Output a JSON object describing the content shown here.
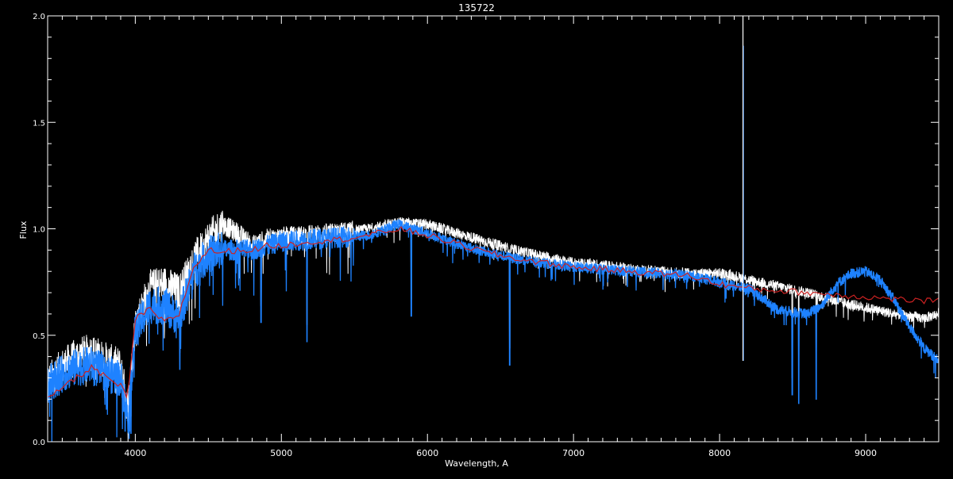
{
  "chart_data": {
    "type": "line",
    "title": "135722",
    "xlabel": "Wavelength, A",
    "ylabel": "Flux",
    "xlim": [
      3400,
      9500
    ],
    "ylim": [
      0.0,
      2.0
    ],
    "x_ticks": [
      4000,
      5000,
      6000,
      7000,
      8000,
      9000
    ],
    "x_tick_labels": [
      "4000",
      "5000",
      "6000",
      "7000",
      "8000",
      "9000"
    ],
    "y_ticks": [
      0.0,
      0.5,
      1.0,
      1.5,
      2.0
    ],
    "y_tick_labels": [
      "0.0",
      "0.5",
      "1.0",
      "1.5",
      "2.0"
    ],
    "grid": false,
    "background": "#000000",
    "series": [
      {
        "color": "#ffffff",
        "style": "noisy-spectrum",
        "x": [
          3400,
          3500,
          3600,
          3700,
          3800,
          3900,
          3950,
          4000,
          4100,
          4200,
          4300,
          4400,
          4500,
          4600,
          4700,
          4800,
          4900,
          5000,
          5200,
          5400,
          5600,
          5800,
          6000,
          6200,
          6400,
          6600,
          6800,
          7000,
          7200,
          7400,
          7600,
          7800,
          8000,
          8100,
          8200,
          8400,
          8600,
          8800,
          9000,
          9200,
          9400,
          9500
        ],
        "y": [
          0.28,
          0.35,
          0.4,
          0.42,
          0.38,
          0.35,
          0.15,
          0.55,
          0.72,
          0.74,
          0.7,
          0.85,
          0.95,
          1.02,
          0.98,
          0.92,
          0.95,
          0.96,
          0.97,
          0.98,
          1.0,
          1.03,
          1.02,
          0.98,
          0.94,
          0.9,
          0.87,
          0.84,
          0.83,
          0.81,
          0.8,
          0.79,
          0.79,
          0.78,
          0.76,
          0.73,
          0.7,
          0.66,
          0.63,
          0.6,
          0.58,
          0.6
        ]
      },
      {
        "color": "#1e82ff",
        "style": "noisy-spectrum",
        "x": [
          3400,
          3500,
          3600,
          3700,
          3800,
          3900,
          3950,
          4000,
          4100,
          4200,
          4300,
          4400,
          4500,
          4600,
          4700,
          4800,
          4900,
          5000,
          5200,
          5400,
          5600,
          5800,
          6000,
          6200,
          6400,
          6600,
          6800,
          7000,
          7200,
          7400,
          7600,
          7800,
          8000,
          8100,
          8200,
          8400,
          8600,
          8700,
          8800,
          8900,
          9000,
          9100,
          9200,
          9300,
          9400,
          9500
        ],
        "y": [
          0.27,
          0.32,
          0.35,
          0.36,
          0.32,
          0.3,
          0.12,
          0.52,
          0.64,
          0.64,
          0.58,
          0.8,
          0.88,
          0.9,
          0.9,
          0.9,
          0.92,
          0.94,
          0.95,
          0.96,
          0.97,
          1.02,
          0.98,
          0.93,
          0.89,
          0.86,
          0.84,
          0.82,
          0.81,
          0.8,
          0.79,
          0.78,
          0.75,
          0.73,
          0.72,
          0.62,
          0.6,
          0.64,
          0.74,
          0.79,
          0.8,
          0.76,
          0.66,
          0.54,
          0.44,
          0.38
        ]
      },
      {
        "color": "#cc2222",
        "style": "smooth-stepped",
        "x": [
          3400,
          3450,
          3500,
          3600,
          3700,
          3800,
          3900,
          3950,
          4000,
          4100,
          4200,
          4300,
          4400,
          4500,
          4600,
          4700,
          4800,
          4900,
          5000,
          5200,
          5400,
          5600,
          5800,
          6000,
          6200,
          6400,
          6600,
          6800,
          7000,
          7200,
          7400,
          7600,
          7800,
          8000,
          8200,
          8400,
          8600,
          8800,
          9000,
          9200,
          9400,
          9500
        ],
        "y": [
          0.2,
          0.22,
          0.26,
          0.3,
          0.35,
          0.3,
          0.26,
          0.2,
          0.58,
          0.62,
          0.56,
          0.6,
          0.82,
          0.9,
          0.89,
          0.9,
          0.9,
          0.92,
          0.92,
          0.94,
          0.95,
          0.97,
          1.0,
          0.97,
          0.93,
          0.89,
          0.86,
          0.84,
          0.82,
          0.81,
          0.8,
          0.79,
          0.78,
          0.74,
          0.72,
          0.71,
          0.7,
          0.69,
          0.68,
          0.67,
          0.66,
          0.66
        ]
      }
    ],
    "emission_spikes": [
      {
        "x": 8163,
        "y": 1.86,
        "color": "#1e82ff"
      },
      {
        "x": 8160,
        "y": 2.0,
        "color": "#ffffff"
      }
    ],
    "absorption_dips": [
      {
        "x": 3930,
        "y": 0.05
      },
      {
        "x": 3970,
        "y": 0.04
      },
      {
        "x": 4305,
        "y": 0.34
      },
      {
        "x": 4861,
        "y": 0.56
      },
      {
        "x": 5175,
        "y": 0.47
      },
      {
        "x": 5890,
        "y": 0.59
      },
      {
        "x": 6563,
        "y": 0.36
      },
      {
        "x": 8498,
        "y": 0.22
      },
      {
        "x": 8542,
        "y": 0.18
      },
      {
        "x": 8662,
        "y": 0.2
      }
    ]
  }
}
